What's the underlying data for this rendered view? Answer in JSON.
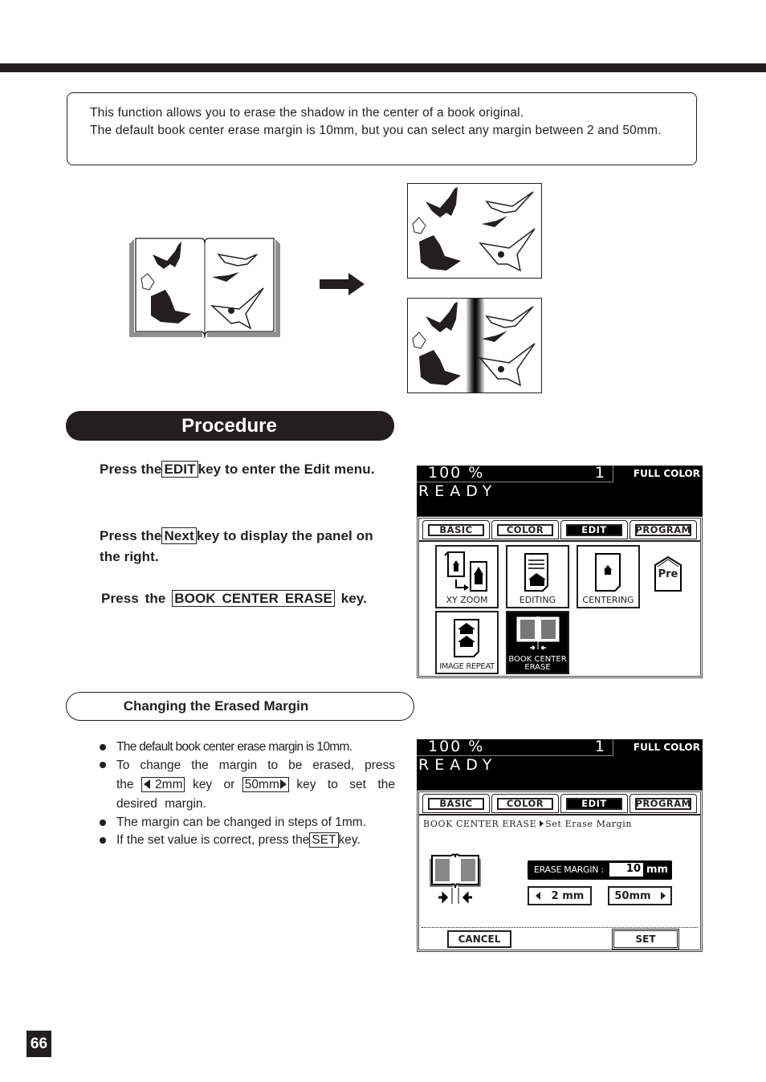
{
  "intro": {
    "line1": "This function allows you to erase the shadow in the center of a book original.",
    "line2": "The default book center erase margin is 10mm, but you can select any margin between 2 and 50mm."
  },
  "illustration": {
    "original": "open-book-original",
    "result_with_erase": "copy-without-center-shadow",
    "result_without_erase": "copy-with-center-shadow",
    "arrow": "right-arrow"
  },
  "procedure": {
    "title": "Procedure",
    "steps": [
      {
        "pre": "Press the",
        "key": "EDIT",
        "post": "key to enter the Edit menu."
      },
      {
        "pre": "Press the",
        "key": "Next",
        "post": "key to display the panel on the right."
      },
      {
        "pre": "Press the",
        "key": "BOOK CENTER ERASE",
        "post": "key."
      }
    ]
  },
  "subsection": {
    "title": "Changing the Erased Margin",
    "bullets": [
      "The default book center erase margin is 10mm.",
      {
        "a": "To change the margin to be erased, press the",
        "key1": "2mm",
        "b": "key or",
        "key2": "50mm",
        "c": "key to set the desired margin."
      },
      "The margin can be changed in steps of 1mm.",
      {
        "a": "If the set value is correct, press the",
        "key": "SET",
        "b": "key."
      }
    ]
  },
  "lcd": {
    "zoom": "100 %",
    "count": "1",
    "mode": "FULL COLOR",
    "status": "READY",
    "tabs": [
      "BASIC",
      "COLOR",
      "EDIT",
      "PROGRAM"
    ],
    "active_tab": "EDIT",
    "edit_keys": [
      "XY ZOOM",
      "EDITING",
      "CENTERING",
      "IMAGE REPEAT",
      "BOOK CENTER ERASE"
    ],
    "edit_key_bce_line1": "BOOK CENTER",
    "edit_key_bce_line2": "ERASE",
    "pre_key": "Pre",
    "breadcrumb_main": "BOOK CENTER ERASE",
    "breadcrumb_sub": "Set Erase Margin",
    "erase_margin_label": "ERASE MARGIN :",
    "erase_margin_value": "10",
    "erase_margin_unit": "mm",
    "min_btn": "2 mm",
    "max_btn": "50mm",
    "cancel": "CANCEL",
    "set": "SET"
  },
  "page_number": "66"
}
